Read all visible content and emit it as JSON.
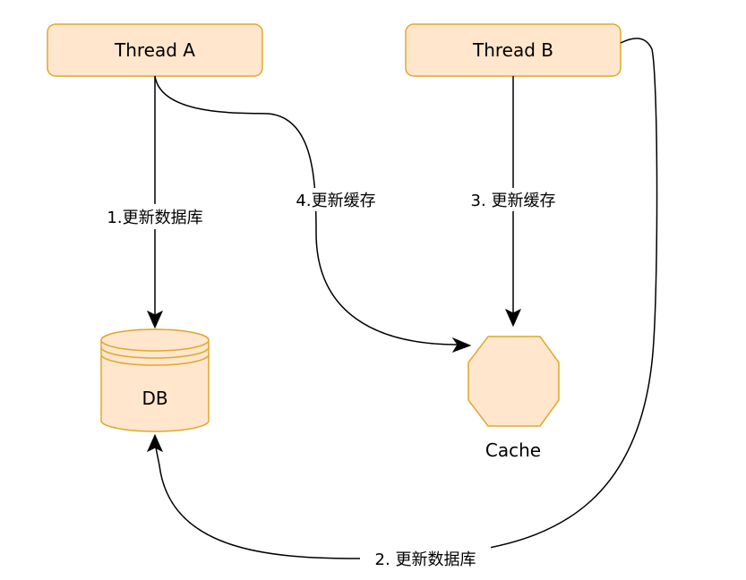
{
  "nodes": {
    "thread_a": {
      "label": "Thread A"
    },
    "thread_b": {
      "label": "Thread B"
    },
    "db": {
      "label": "DB"
    },
    "cache": {
      "label": "Cache"
    }
  },
  "edges": {
    "a_to_db": {
      "label": "1.更新数据库"
    },
    "b_to_db": {
      "label": "2. 更新数据库"
    },
    "b_to_cache": {
      "label": "3. 更新缓存"
    },
    "a_to_cache": {
      "label": "4.更新缓存"
    }
  },
  "colors": {
    "node_fill": "#ffe6cc",
    "node_stroke": "#e0a72f",
    "edge": "#000000"
  }
}
